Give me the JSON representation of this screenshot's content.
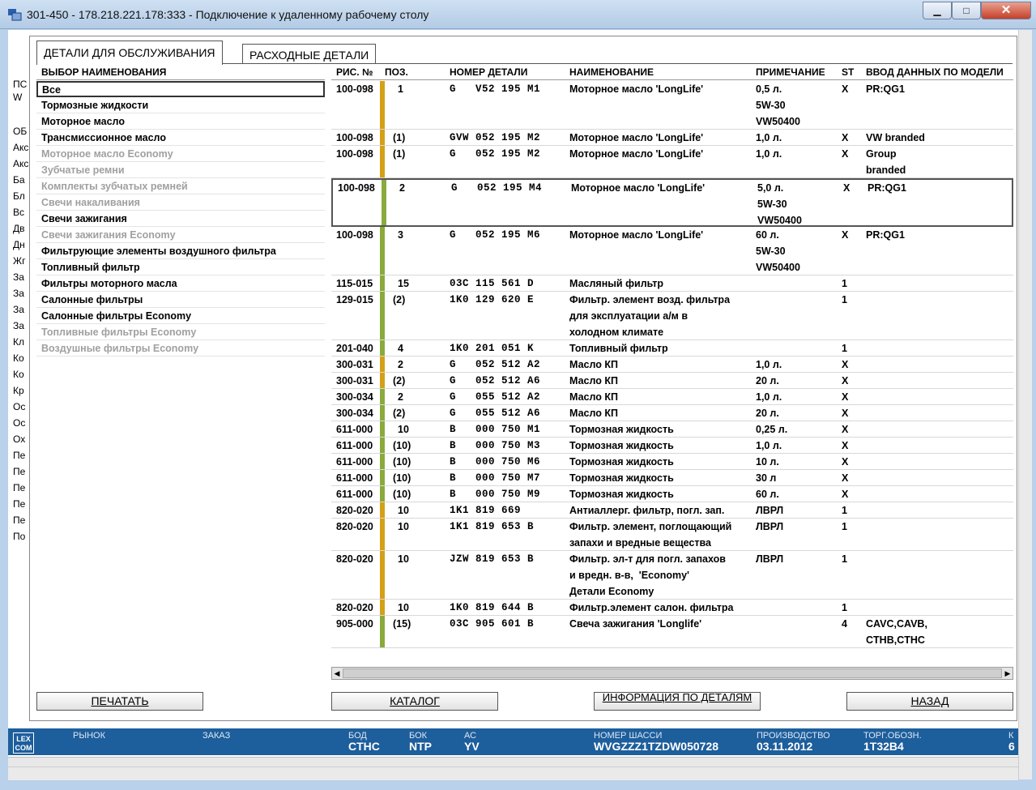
{
  "window": {
    "title": "301-450 - 178.218.221.178:333 - Подключение к удаленному рабочему столу",
    "min": "▁",
    "max": "□",
    "close": "✕"
  },
  "background": {
    "labels": [
      "ПС",
      "W",
      "ОБ",
      "Акс",
      "Акс",
      "Ба",
      "Бл",
      "Вс",
      "Дв",
      "Дн",
      "Жг",
      "За",
      "За",
      "За",
      "За",
      "Кл",
      "Ко",
      "Ко",
      "Кр",
      "Ос",
      "Ос",
      "Ох",
      "Пе",
      "Пе",
      "Пе",
      "Пе",
      "Пе",
      "По"
    ]
  },
  "tabs": {
    "tab1": "ДЕТАЛИ ДЛЯ ОБСЛУЖИВАНИЯ",
    "tab2": "РАСХОДНЫЕ ДЕТАЛИ"
  },
  "list": {
    "header": "ВЫБОР НАИМЕНОВАНИЯ",
    "items": [
      {
        "label": "Все",
        "state": "selected"
      },
      {
        "label": "Тормозные жидкости",
        "state": "enabled"
      },
      {
        "label": "Моторное масло",
        "state": "enabled"
      },
      {
        "label": "Трансмиссионное масло",
        "state": "enabled"
      },
      {
        "label": "Моторное масло Economy",
        "state": "disabled"
      },
      {
        "label": "Зубчатые ремни",
        "state": "disabled"
      },
      {
        "label": "Комплекты зубчатых ремней",
        "state": "disabled"
      },
      {
        "label": "Свечи накаливания",
        "state": "disabled"
      },
      {
        "label": "Свечи зажигания",
        "state": "enabled"
      },
      {
        "label": "Свечи зажигания Economy",
        "state": "disabled"
      },
      {
        "label": "Фильтрующие элементы воздушного фильтра",
        "state": "enabled"
      },
      {
        "label": "Топливный фильтр",
        "state": "enabled"
      },
      {
        "label": "Фильтры моторного масла",
        "state": "enabled"
      },
      {
        "label": "Салонные фильтры",
        "state": "enabled"
      },
      {
        "label": "Салонные фильтры Economy",
        "state": "enabled"
      },
      {
        "label": "Топливные фильтры Economy",
        "state": "disabled"
      },
      {
        "label": "Воздушные фильтры Economy",
        "state": "disabled"
      }
    ]
  },
  "table": {
    "headers": {
      "ris": "РИС. №",
      "poz": "ПОЗ.",
      "num": "НОМЕР ДЕТАЛИ",
      "name": "НАИМЕНОВАНИЕ",
      "note": "ПРИМЕЧАНИЕ",
      "st": "ST",
      "model": "ВВОД ДАННЫХ ПО МОДЕЛИ"
    },
    "colors": {
      "yellow": "#d4a017",
      "green": "#8aaa3c"
    },
    "rows": [
      {
        "ris": "100-098",
        "poz": "1",
        "num": "G   V52 195 M1",
        "name": "Моторное масло 'LongLife'",
        "note": "0,5 л.\n5W-30\nVW50400",
        "st": "X",
        "model": "PR:QG1",
        "bar": "yellow",
        "lines": 3
      },
      {
        "ris": "100-098",
        "poz": "(1)",
        "num": "GVW 052 195 M2",
        "name": "Моторное масло 'LongLife'",
        "note": "1,0 л.",
        "st": "X",
        "model": "VW branded",
        "bar": "yellow",
        "lines": 1
      },
      {
        "ris": "100-098",
        "poz": "(1)",
        "num": "G   052 195 M2",
        "name": "Моторное масло 'LongLife'",
        "note": "1,0 л.",
        "st": "X",
        "model": "Group\nbranded",
        "bar": "yellow",
        "lines": 2
      },
      {
        "ris": "100-098",
        "poz": "2",
        "num": "G   052 195 M4",
        "name": "Моторное масло 'LongLife'",
        "note": "5,0 л.\n5W-30\nVW50400",
        "st": "X",
        "model": "PR:QG1",
        "bar": "green",
        "lines": 3,
        "hl": true
      },
      {
        "ris": "100-098",
        "poz": "3",
        "num": "G   052 195 M6",
        "name": "Моторное масло 'LongLife'",
        "note": "60 л.\n5W-30\nVW50400",
        "st": "X",
        "model": "PR:QG1",
        "bar": "green",
        "lines": 3
      },
      {
        "ris": "115-015",
        "poz": "15",
        "num": "03C 115 561 D",
        "name": "Масляный фильтр",
        "note": "",
        "st": "1",
        "model": "",
        "bar": "green",
        "lines": 1
      },
      {
        "ris": "129-015",
        "poz": "(2)",
        "num": "1K0 129 620 E",
        "name": "Фильтр. элемент возд. фильтра\nдля эксплуатации а/м в\nхолодном климате",
        "note": "",
        "st": "1",
        "model": "",
        "bar": "green",
        "lines": 3
      },
      {
        "ris": "201-040",
        "poz": "4",
        "num": "1K0 201 051 K",
        "name": "Топливный фильтр",
        "note": "",
        "st": "1",
        "model": "",
        "bar": "green",
        "lines": 1
      },
      {
        "ris": "300-031",
        "poz": "2",
        "num": "G   052 512 A2",
        "name": "Масло КП",
        "note": "1,0 л.",
        "st": "X",
        "model": "",
        "bar": "yellow",
        "lines": 1
      },
      {
        "ris": "300-031",
        "poz": "(2)",
        "num": "G   052 512 A6",
        "name": "Масло КП",
        "note": "20 л.",
        "st": "X",
        "model": "",
        "bar": "yellow",
        "lines": 1
      },
      {
        "ris": "300-034",
        "poz": "2",
        "num": "G   055 512 A2",
        "name": "Масло КП",
        "note": "1,0 л.",
        "st": "X",
        "model": "",
        "bar": "green",
        "lines": 1
      },
      {
        "ris": "300-034",
        "poz": "(2)",
        "num": "G   055 512 A6",
        "name": "Масло КП",
        "note": "20 л.",
        "st": "X",
        "model": "",
        "bar": "green",
        "lines": 1
      },
      {
        "ris": "611-000",
        "poz": "10",
        "num": "B   000 750 M1",
        "name": "Тормозная жидкость",
        "note": "0,25 л.",
        "st": "X",
        "model": "",
        "bar": "green",
        "lines": 1
      },
      {
        "ris": "611-000",
        "poz": "(10)",
        "num": "B   000 750 M3",
        "name": "Тормозная жидкость",
        "note": "1,0 л.",
        "st": "X",
        "model": "",
        "bar": "green",
        "lines": 1
      },
      {
        "ris": "611-000",
        "poz": "(10)",
        "num": "B   000 750 M6",
        "name": "Тормозная жидкость",
        "note": "10 л.",
        "st": "X",
        "model": "",
        "bar": "green",
        "lines": 1
      },
      {
        "ris": "611-000",
        "poz": "(10)",
        "num": "B   000 750 M7",
        "name": "Тормозная жидкость",
        "note": "30 л",
        "st": "X",
        "model": "",
        "bar": "green",
        "lines": 1
      },
      {
        "ris": "611-000",
        "poz": "(10)",
        "num": "B   000 750 M9",
        "name": "Тормозная жидкость",
        "note": "60 л.",
        "st": "X",
        "model": "",
        "bar": "green",
        "lines": 1
      },
      {
        "ris": "820-020",
        "poz": "10",
        "num": "1K1 819 669",
        "name": "Антиаллерг. фильтр, погл. зап.",
        "note": "ЛВРЛ",
        "st": "1",
        "model": "",
        "bar": "yellow",
        "lines": 1
      },
      {
        "ris": "820-020",
        "poz": "10",
        "num": "1K1 819 653 B",
        "name": "Фильтр. элемент, поглощающий\nзапахи и вредные вещества",
        "note": "ЛВРЛ",
        "st": "1",
        "model": "",
        "bar": "yellow",
        "lines": 2
      },
      {
        "ris": "820-020",
        "poz": "10",
        "num": "JZW 819 653 B",
        "name": "Фильтр. эл-т для погл. запахов\nи вредн. в-в,  'Economy'\nДетали Economy",
        "note": "ЛВРЛ",
        "st": "1",
        "model": "",
        "bar": "yellow",
        "lines": 3
      },
      {
        "ris": "820-020",
        "poz": "10",
        "num": "1K0 819 644 B",
        "name": "Фильтр.элемент салон. фильтра",
        "note": "",
        "st": "1",
        "model": "",
        "bar": "yellow",
        "lines": 1
      },
      {
        "ris": "905-000",
        "poz": "(15)",
        "num": "03C 905 601 B",
        "name": "Свеча зажигания 'Longlife'",
        "note": "",
        "st": "4",
        "model": "CAVC,CAVB,\nCTHB,CTHC",
        "bar": "green",
        "lines": 2
      }
    ]
  },
  "buttons": {
    "print": "ПЕЧАТАТЬ",
    "catalog": "КАТАЛОГ",
    "info": "ИНФОРМАЦИЯ ПО ДЕТАЛЯМ",
    "back": "НАЗАД"
  },
  "status": {
    "logo": "LEX\nCOM",
    "market": "РЫНОК",
    "order": "ЗАКАЗ",
    "bod_l": "БОД",
    "bod_v": "CTHC",
    "bok_l": "БОК",
    "bok_v": "NTP",
    "ac_l": "АС",
    "ac_v": "YV",
    "chassis_l": "НОМЕР ШАССИ",
    "chassis_v": "WVGZZZ1TZDW050728",
    "prod_l": "ПРОИЗВОДСТВО",
    "prod_v": "03.11.2012",
    "torg_l": "ТОРГ.ОБОЗН.",
    "torg_v": "1T32B4",
    "k_l": "К",
    "k_v": "6"
  }
}
